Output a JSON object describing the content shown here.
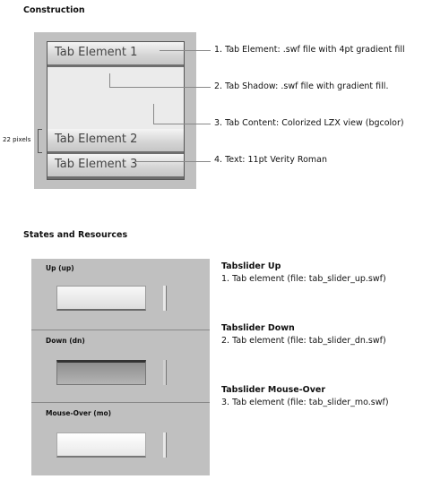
{
  "construction": {
    "title": "Construction",
    "tabs": [
      "Tab Element 1",
      "Tab Element 2",
      "Tab Element 3"
    ],
    "callouts": [
      "1. Tab Element: .swf file with 4pt gradient fill",
      "2. Tab Shadow: .swf file with gradient fill.",
      "3. Tab Content: Colorized LZX view (bgcolor)",
      "4. Text: 11pt Verity Roman"
    ],
    "height_label": "22 pixels"
  },
  "states": {
    "title": "States and Resources",
    "panels": [
      {
        "label": "Up (up)"
      },
      {
        "label": "Down (dn)"
      },
      {
        "label": "Mouse-Over (mo)"
      }
    ],
    "resources": [
      {
        "title": "Tabslider Up",
        "desc": "1. Tab element (file: tab_slider_up.swf)"
      },
      {
        "title": "Tabslider Down",
        "desc": "2. Tab element (file: tab_slider_dn.swf)"
      },
      {
        "title": "Tabslider Mouse-Over",
        "desc": "3. Tab element (file: tab_slider_mo.swf)"
      }
    ]
  }
}
